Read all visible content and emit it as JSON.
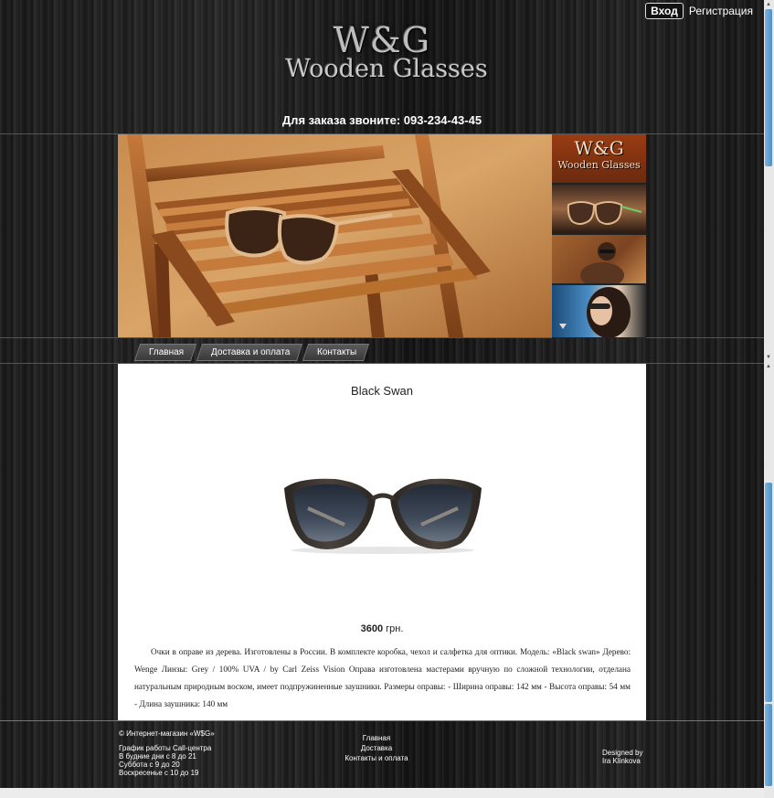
{
  "header": {
    "logo_line1": "W&G",
    "logo_line2": "Wooden Glasses",
    "phone": "Для заказа звоните: 093-234-43-45",
    "login_label": "Вход",
    "register_label": "Регистрация"
  },
  "slider": {
    "thumb_logo_line1": "W&G",
    "thumb_logo_line2": "Wooden Glasses"
  },
  "nav": {
    "items": [
      "Главная",
      "Доставка и оплата",
      "Контакты"
    ]
  },
  "product": {
    "title": "Black Swan",
    "price_value": "3600",
    "price_currency": " грн.",
    "description": "Очки в оправе из дерева. Изготовлены в России. В комплекте коробка, чехол и салфетка для оптики. Модель: «Black swan» Дерево: Wenge Линзы: Grey / 100% UVA / by Carl Zeiss Vision Оправа изготовлена мастерами вручную по сложной технологии, отделана натуральным природным воском, имеет подпружиненные заушники. Размеры оправы: - Ширина оправы: 142 мм - Высота оправы: 54 мм - Длина заушника: 140 мм"
  },
  "footer": {
    "copyright": "© Интернет-магазин «W$G»",
    "hours_title": "График работы Call-центра",
    "hours_weekdays": "В будние дни с 8 до 21",
    "hours_saturday": "Суббота с 9 до 20",
    "hours_sunday": "Воскресенье с 10 до 19",
    "links": [
      "Главная",
      "Доставка",
      "Контакты и оплата"
    ],
    "designed_by_line1": "Designed by",
    "designed_by_line2": "Ira Klinkova"
  },
  "colors": {
    "background": "#1a1a1a",
    "content_bg": "#ffffff",
    "scrollbar_thumb": "#4f8fc4"
  }
}
